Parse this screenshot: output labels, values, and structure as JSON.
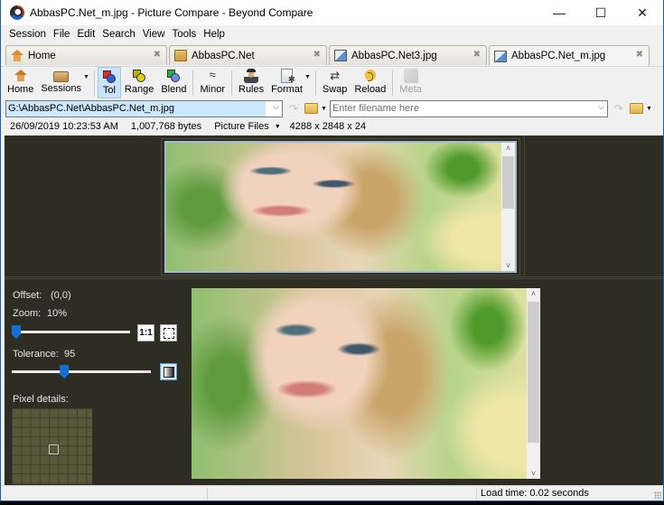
{
  "window": {
    "title": "AbbasPC.Net_m.jpg - Picture Compare - Beyond Compare",
    "controls": {
      "minimize": "—",
      "maximize": "☐",
      "close": "✕"
    }
  },
  "menu": [
    "Session",
    "File",
    "Edit",
    "Search",
    "View",
    "Tools",
    "Help"
  ],
  "tabs": [
    {
      "label": "Home",
      "icon": "home-icon",
      "active": false
    },
    {
      "label": "AbbasPC.Net",
      "icon": "folder-compare-icon",
      "active": false
    },
    {
      "label": "AbbasPC.Net3.jpg",
      "icon": "picture-compare-icon",
      "active": false
    },
    {
      "label": "AbbasPC.Net_m.jpg",
      "icon": "picture-compare-icon",
      "active": true
    }
  ],
  "tab_close_glyph": "✖",
  "toolbar": {
    "home": "Home",
    "sessions": "Sessions",
    "tol": "Tol",
    "range": "Range",
    "blend": "Blend",
    "minor": "Minor",
    "rules": "Rules",
    "format": "Format",
    "swap": "Swap",
    "reload": "Reload",
    "meta": "Meta",
    "pressed": "Tol",
    "dropdown_glyph": "▼",
    "minor_glyph": "≈",
    "swap_glyph": "⇄"
  },
  "paths": {
    "left_value": "G:\\AbbasPC.Net\\AbbasPC.Net_m.jpg",
    "right_value": "",
    "right_placeholder": "Enter filename here",
    "combo_arrow": "⌵",
    "next_glyph": "↷"
  },
  "file_info": {
    "date": "26/09/2019 10:23:53 AM",
    "size": "1,007,768 bytes",
    "format": "Picture Files",
    "dimensions": "4288 x 2848 x 24"
  },
  "side_panel": {
    "offset_label": "Offset:",
    "offset_value": "(0,0)",
    "zoom_label": "Zoom:",
    "zoom_value": "10%",
    "zoom_slider_fraction": 0.0,
    "actual_size_label": "1:1",
    "tolerance_label": "Tolerance:",
    "tolerance_value": "95",
    "tolerance_slider_fraction": 0.37,
    "pixel_details_label": "Pixel details:"
  },
  "scrollbars": {
    "up_glyph": "˄",
    "down_glyph": "˅",
    "top_pane_thumb_fraction": [
      0.0,
      0.5
    ],
    "bottom_pane_thumb_fraction": [
      0.0,
      0.86
    ]
  },
  "status": {
    "load_time": "Load time: 0.02 seconds"
  }
}
